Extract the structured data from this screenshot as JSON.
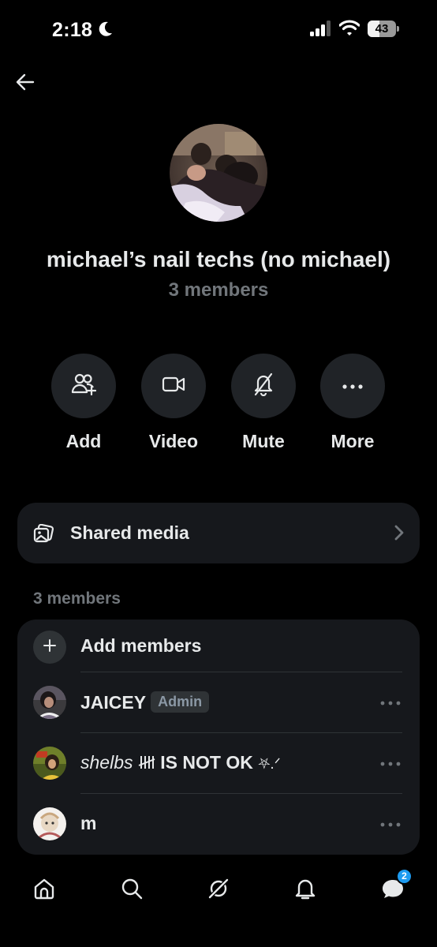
{
  "status_bar": {
    "time": "2:18",
    "battery_level": "43",
    "icons": [
      "moon-icon",
      "signal-icon",
      "wifi-icon",
      "battery-icon"
    ]
  },
  "header": {
    "back_icon": "arrow-left-icon"
  },
  "group": {
    "name": "michael’s nail techs (no michael)",
    "member_count": "3 members"
  },
  "actions": [
    {
      "label": "Add",
      "icon": "add-people-icon"
    },
    {
      "label": "Video",
      "icon": "video-icon"
    },
    {
      "label": "Mute",
      "icon": "bell-off-icon"
    },
    {
      "label": "More",
      "icon": "more-icon"
    }
  ],
  "shared_media": {
    "label": "Shared media",
    "icon": "media-icon"
  },
  "members_section": {
    "heading": "3 members",
    "add_label": "Add members",
    "members": [
      {
        "name": "JAICEY",
        "badge": "Admin"
      },
      {
        "name_prefix": "shelbs",
        "name_rest": "IS NOT OK",
        "name_suffix": "⛧.ᐟ"
      },
      {
        "name": "m"
      }
    ]
  },
  "bottom_nav": {
    "items": [
      "home-icon",
      "search-icon",
      "grok-icon",
      "notifications-icon",
      "messages-icon"
    ],
    "messages_badge": "2"
  },
  "colors": {
    "background": "#000000",
    "surface": "#16181c",
    "text_primary": "#e7e9ea",
    "text_secondary": "#71767b",
    "accent": "#1d9bf0"
  }
}
